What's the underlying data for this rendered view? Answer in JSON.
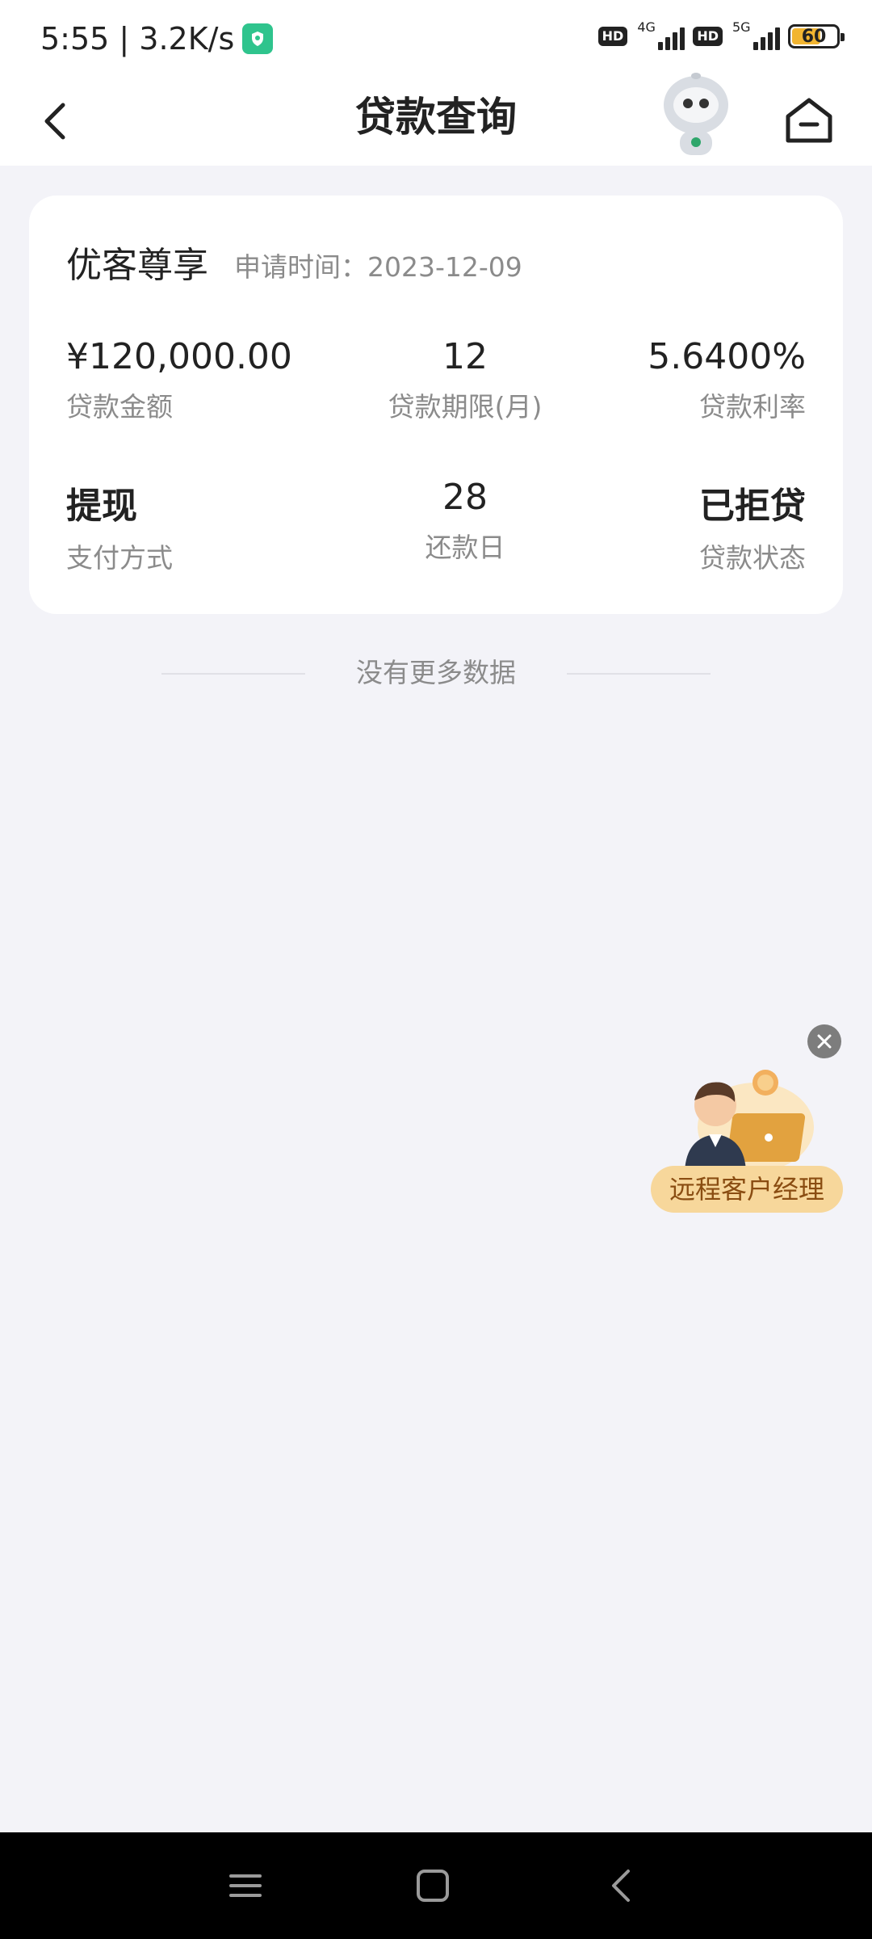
{
  "status_bar": {
    "time_speed": "5:55 | 3.2K/s",
    "hd1": "HD",
    "net1": "4G",
    "hd2": "HD",
    "net2": "5G",
    "battery_level": "60"
  },
  "nav": {
    "title": "贷款查询"
  },
  "loan": {
    "product_name": "优客尊享",
    "apply_time": "申请时间：2023-12-09",
    "amount_value": "¥120,000.00",
    "amount_label": "贷款金额",
    "term_value": "12",
    "term_label": "贷款期限(月)",
    "rate_value": "5.6400%",
    "rate_label": "贷款利率",
    "pay_value": "提现",
    "pay_label": "支付方式",
    "repay_value": "28",
    "repay_label": "还款日",
    "status_value": "已拒贷",
    "status_label": "贷款状态"
  },
  "list_footer": "没有更多数据",
  "floating": {
    "label": "远程客户经理"
  },
  "colors": {
    "background": "#f3f3f8",
    "card": "#ffffff",
    "secondary_text": "#8b8b8b",
    "float_label_bg": "#f7d79b"
  }
}
